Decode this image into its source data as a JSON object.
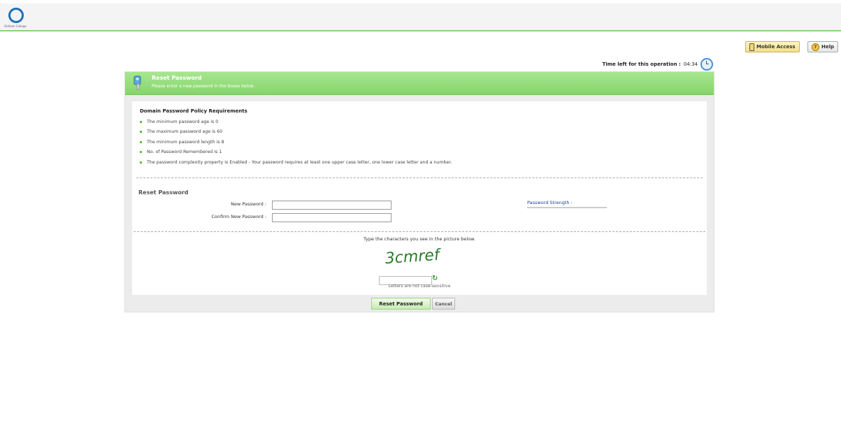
{
  "brand": {
    "logo_text": "Oldham College"
  },
  "topbar": {
    "mobile_access_label": "Mobile Access",
    "help_label": "Help"
  },
  "timer": {
    "label": "Time left for this operation :",
    "value": "04:34"
  },
  "panel": {
    "title": "Reset Password",
    "subtitle": "Please enter a new password in the boxes below."
  },
  "policy": {
    "title": "Domain Password Policy Requirements",
    "items": [
      "The minimum password age is 0",
      "The maximum password age is 60",
      "The minimum password length is 8",
      "No. of Password Remembered is 1",
      "The password complexity property is Enabled - Your password requires at least one upper case letter, one lower case letter and a number."
    ]
  },
  "form": {
    "heading": "Reset Password",
    "new_password_label": "New Password :",
    "confirm_password_label": "Confirm New Password :",
    "new_password_value": "",
    "confirm_password_value": "",
    "strength_label": "Password Strength :"
  },
  "captcha": {
    "prompt": "Type the characters you see in the picture below.",
    "image_text": "3cmref",
    "input_value": "",
    "note": "Letters are not case-sensitive"
  },
  "actions": {
    "reset_label": "Reset Password",
    "cancel_label": "Cancel"
  },
  "colors": {
    "accent_green": "#8ed27a",
    "link_blue": "#1c3f94",
    "captcha_green": "#2c7a2c"
  }
}
